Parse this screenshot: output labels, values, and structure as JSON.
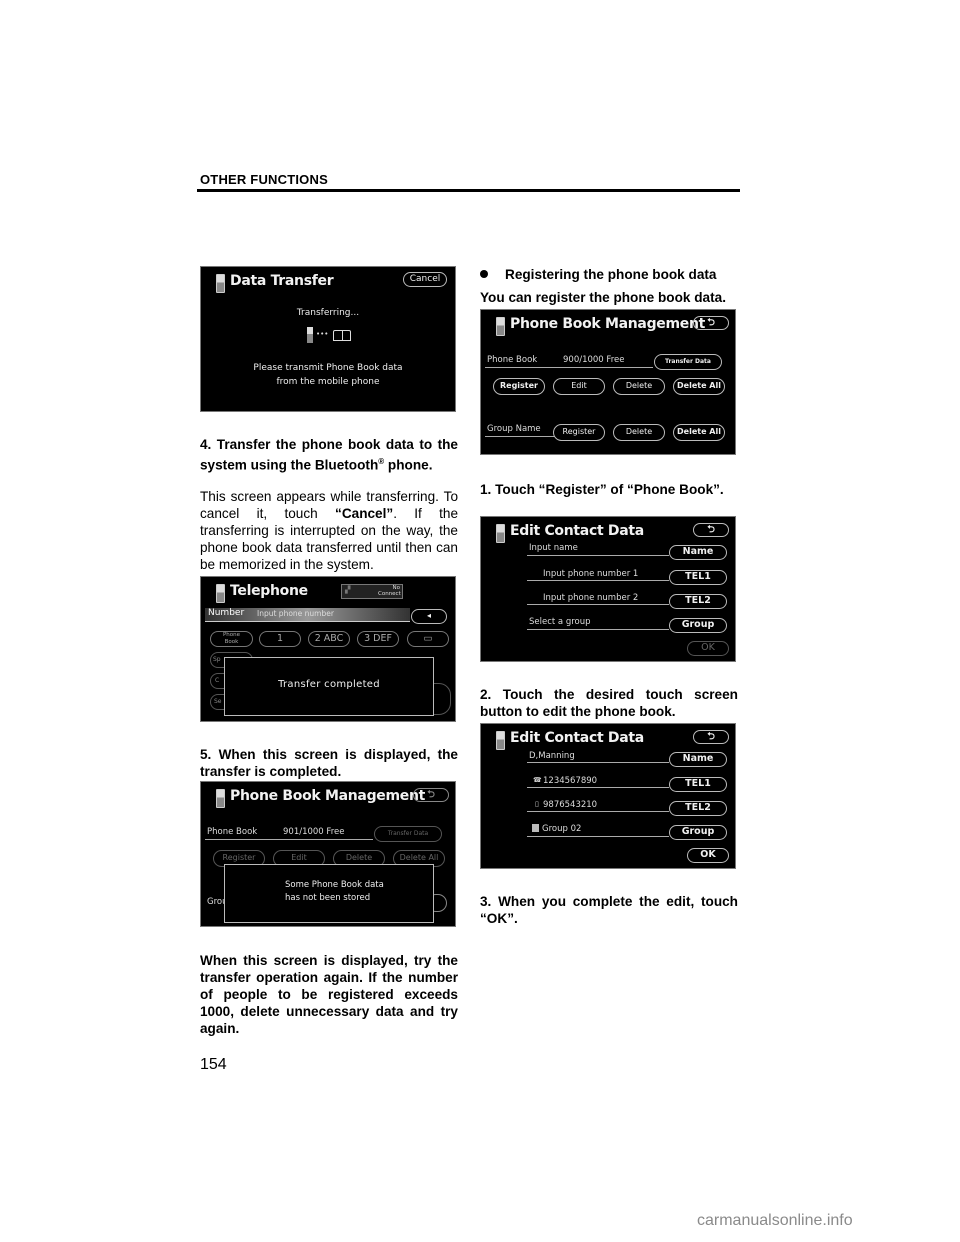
{
  "header": {
    "section": "OTHER FUNCTIONS"
  },
  "left_column": {
    "screen1": {
      "title": "Data Transfer",
      "cancel_button": "Cancel",
      "status": "Transferring...",
      "arrow": "•••",
      "message_line1": "Please transmit Phone Book data",
      "message_line2": "from the mobile phone"
    },
    "step4_heading": "4.  Transfer the phone book data to the system using the Bluetooth",
    "step4_heading_reg": "®",
    "step4_heading_tail": " phone.",
    "step4_body_pre": "This screen appears while transferring. To cancel it, touch ",
    "step4_body_bold": "“Cancel”",
    "step4_body_post": ".  If the transferring is interrupted on the way, the phone book data transferred until then can be memorized in the system.",
    "screen2": {
      "title": "Telephone",
      "status_badge": "No Connect",
      "number_label": "Number",
      "number_placeholder": "Input phone number",
      "back_button": "◂",
      "keys_row1": [
        "Phone Book",
        "1",
        "2 ABC",
        "3 DEF",
        "▭"
      ],
      "keys_left": [
        "Sp",
        "C",
        "Se"
      ],
      "dialog_text": "Transfer completed"
    },
    "step5_heading": "5.  When this screen is displayed, the transfer is completed.",
    "screen3": {
      "title": "Phone Book Management",
      "phone_book_label": "Phone Book",
      "free_count": "901/1000 Free",
      "transfer_button": "Transfer Data",
      "buttons": [
        "Register",
        "Edit",
        "Delete",
        "Delete All"
      ],
      "group_label_partial": "Grou",
      "dialog_line1": "Some Phone Book data",
      "dialog_line2": "has not been stored"
    },
    "note_text": "When this screen is displayed, try the transfer operation again.  If the number of people to be registered exceeds 1000, delete unnecessary data and try again."
  },
  "right_column": {
    "bullet_heading": "Registering the phone book data",
    "intro": "You can register the phone book data.",
    "screen4": {
      "title": "Phone Book Management",
      "phone_book_label": "Phone Book",
      "free_count": "900/1000 Free",
      "transfer_button": "Transfer Data",
      "phonebook_buttons": [
        "Register",
        "Edit",
        "Delete",
        "Delete All"
      ],
      "group_label": "Group Name",
      "group_buttons": [
        "Register",
        "Delete",
        "Delete All"
      ]
    },
    "step1": "1.  Touch  “Register”  of  “Phone Book”.",
    "screen5": {
      "title": "Edit Contact Data",
      "rows": [
        {
          "label": "Input name",
          "button": "Name"
        },
        {
          "label": "Input phone number 1",
          "button": "TEL1"
        },
        {
          "label": "Input phone number 2",
          "button": "TEL2"
        },
        {
          "label": "Select a group",
          "button": "Group"
        }
      ],
      "ok_button": "OK"
    },
    "step2": "2.  Touch the desired touch screen button to edit the phone book.",
    "screen6": {
      "title": "Edit Contact Data",
      "rows": [
        {
          "label": "D,Manning",
          "button": "Name"
        },
        {
          "label": "1234567890",
          "button": "TEL1"
        },
        {
          "label": "9876543210",
          "button": "TEL2"
        },
        {
          "label": "Group 02",
          "button": "Group"
        }
      ],
      "ok_button": "OK"
    },
    "step3": "3.  When you complete the edit, touch “OK”."
  },
  "footer": {
    "page_number": "154",
    "watermark": "carmanualsonline.info"
  }
}
